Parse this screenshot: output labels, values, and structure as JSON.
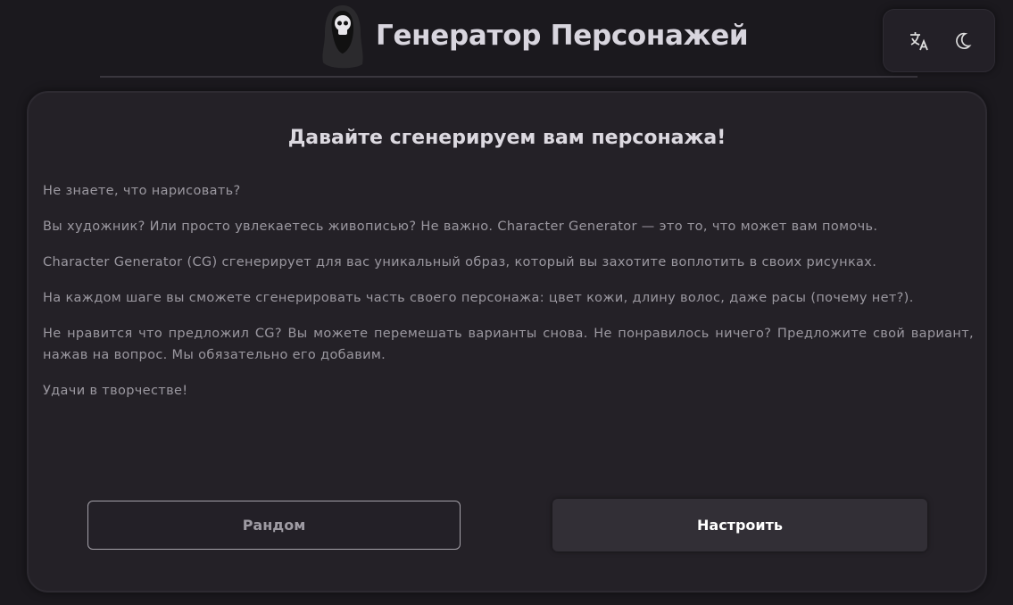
{
  "header": {
    "title": "Генератор Персонажей",
    "icons": {
      "logo": "hooded-skull-logo",
      "translate": "translate-icon",
      "theme": "moon-icon"
    }
  },
  "card": {
    "title": "Давайте сгенерируем вам персонажа!",
    "paragraphs": [
      "Не знаете, что нарисовать?",
      "Вы художник? Или просто увлекаетесь живописью? Не важно. Character Generator — это то, что может вам помочь.",
      "Character Generator (CG) сгенерирует для вас уникальный образ, который вы захотите воплотить в своих рисунках.",
      "На каждом шаге вы сможете сгенерировать часть своего персонажа: цвет кожи, длину волос, даже расы (почему нет?).",
      "Не нравится что предложил CG? Вы можете перемешать варианты снова. Не понравилось ничего? Предложите свой вариант, нажав на вопрос. Мы обязательно его добавим.",
      "Удачи в творчестве!"
    ],
    "buttons": {
      "random": "Рандом",
      "configure": "Настроить"
    }
  }
}
